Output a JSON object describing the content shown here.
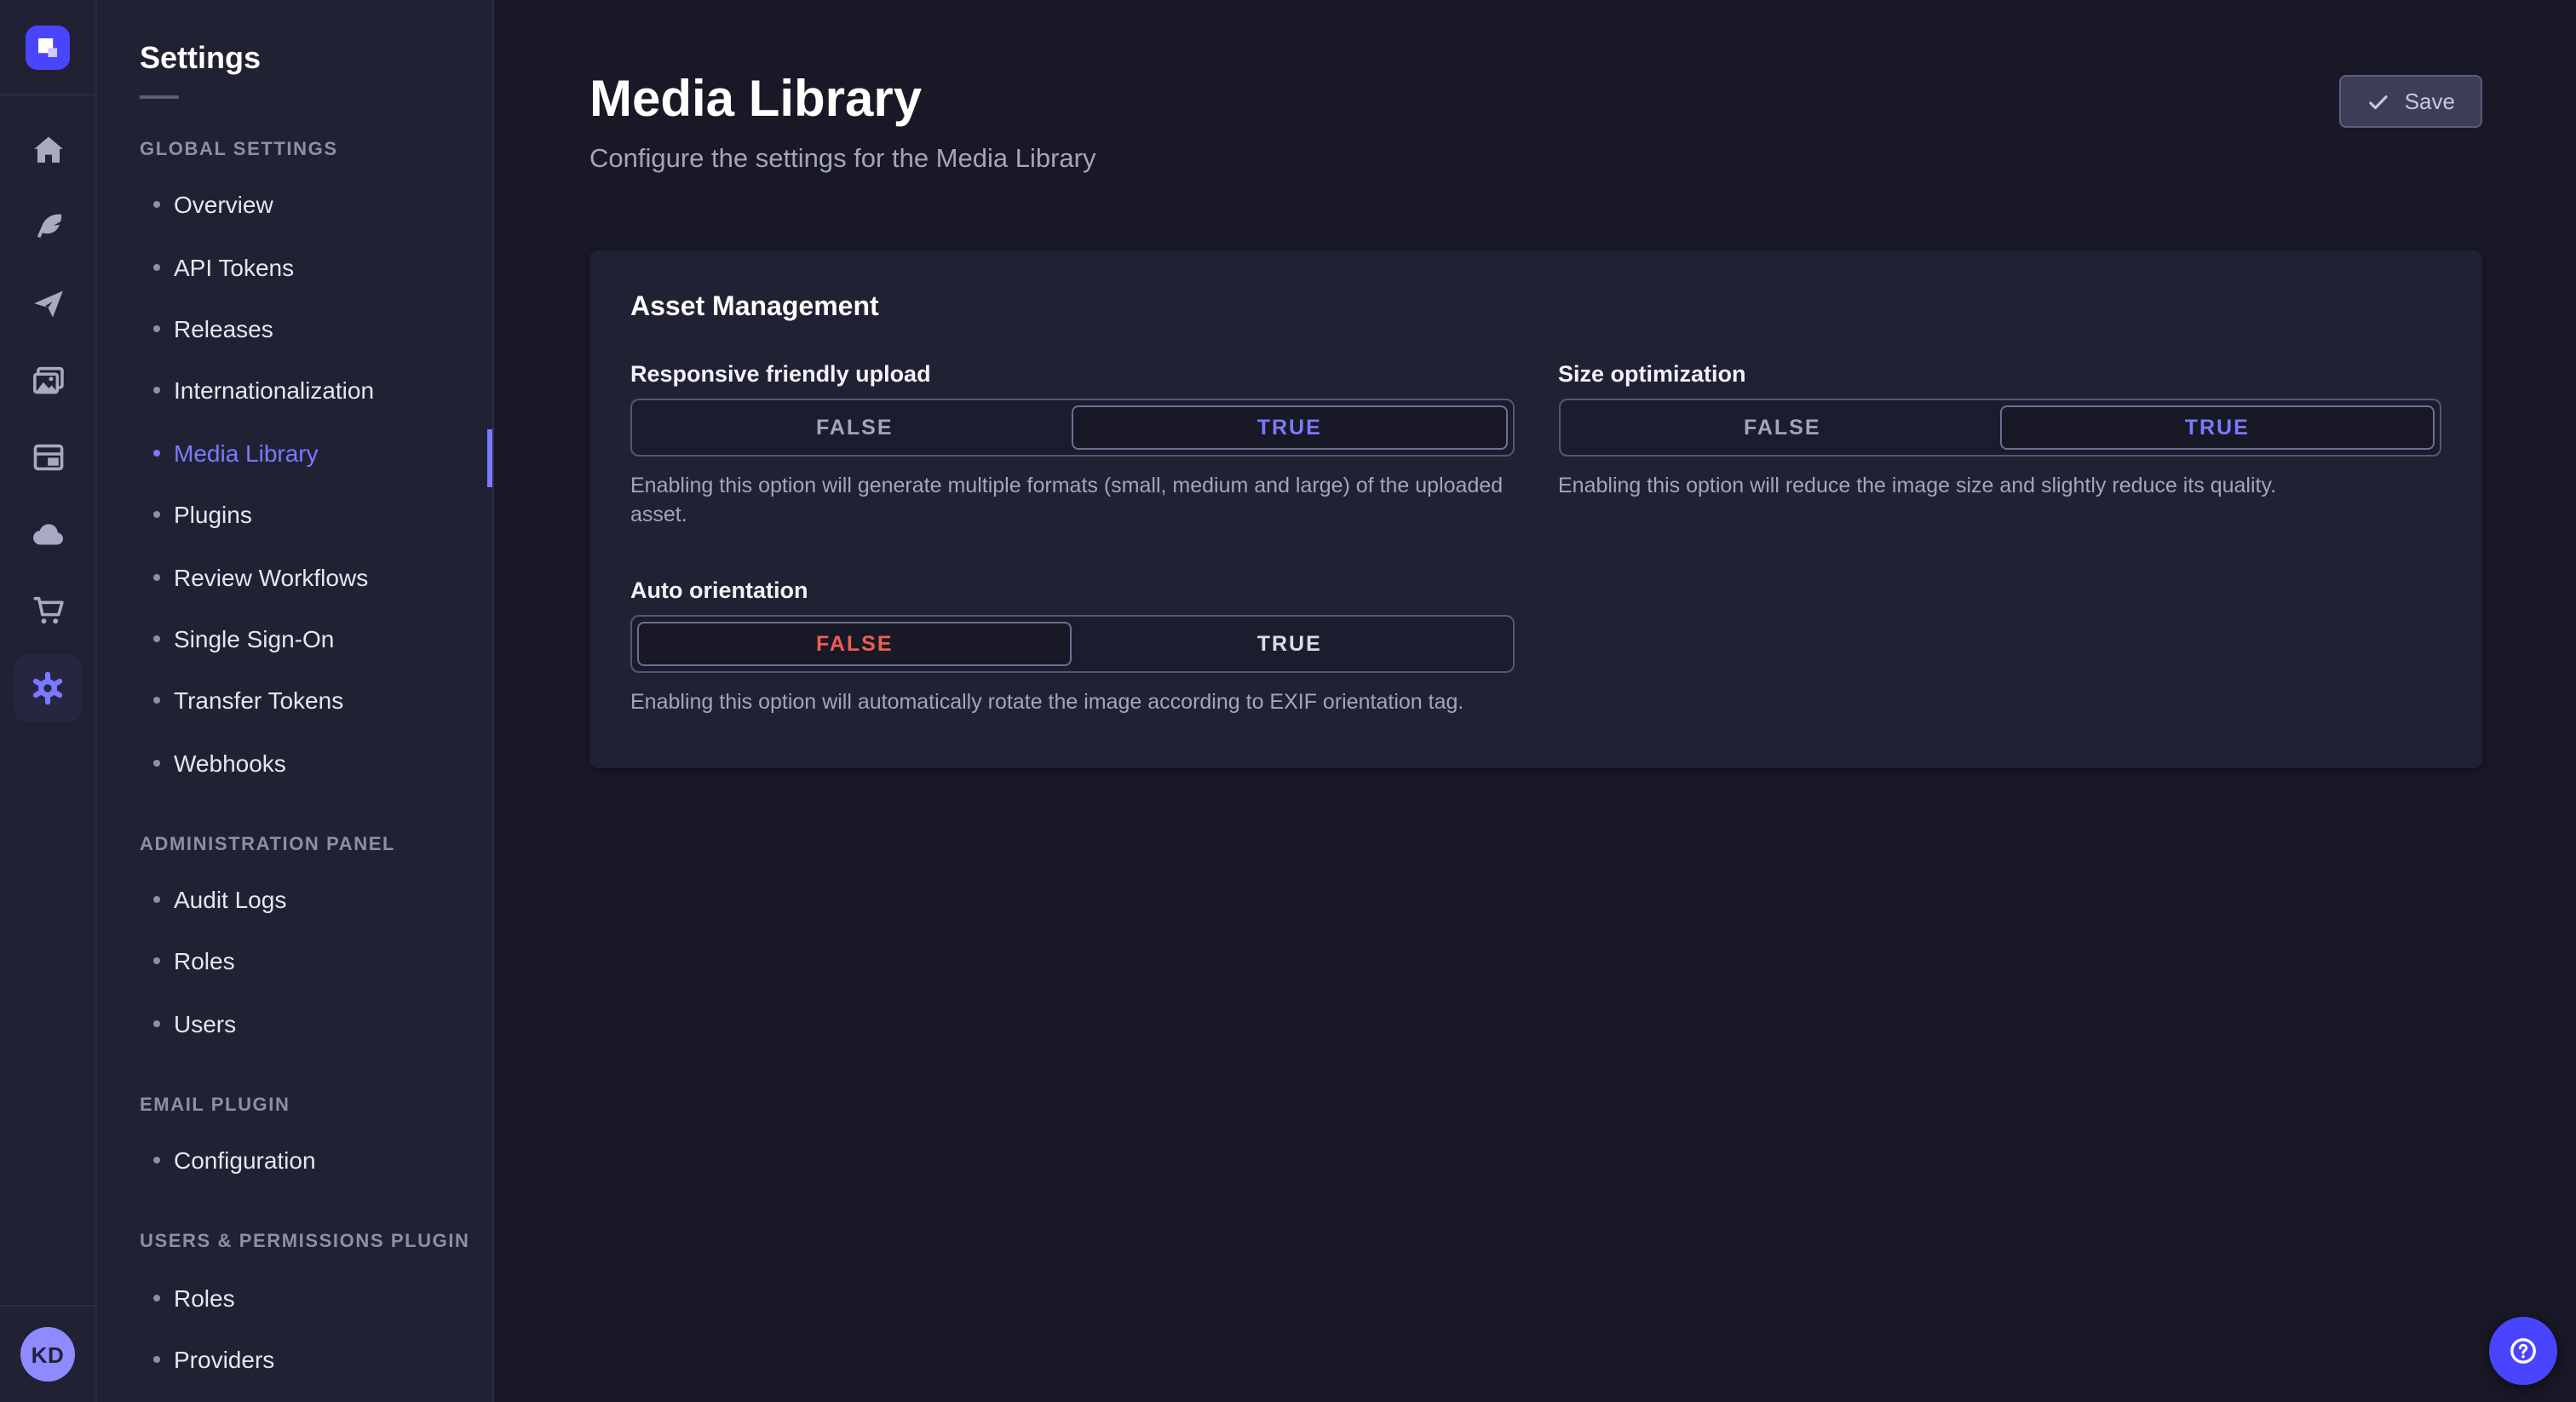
{
  "colors": {
    "background": "#181826",
    "surface": "#212134",
    "accent": "#7b79ff",
    "primary": "#4945ff",
    "danger": "#ee5e52",
    "muted_text": "#a5a5ba"
  },
  "icon_rail": {
    "logo_icon": "strapi-logo",
    "items": [
      "home-icon",
      "feather-icon",
      "paper-plane-icon",
      "pictures-icon",
      "layout-icon",
      "cloud-icon",
      "cart-icon",
      "gear-icon"
    ],
    "active_item": "gear-icon",
    "avatar_initials": "KD"
  },
  "subnav": {
    "title": "Settings",
    "sections": [
      {
        "label": "GLOBAL SETTINGS",
        "items": [
          {
            "label": "Overview"
          },
          {
            "label": "API Tokens"
          },
          {
            "label": "Releases"
          },
          {
            "label": "Internationalization"
          },
          {
            "label": "Media Library",
            "active": true
          },
          {
            "label": "Plugins"
          },
          {
            "label": "Review Workflows"
          },
          {
            "label": "Single Sign-On"
          },
          {
            "label": "Transfer Tokens"
          },
          {
            "label": "Webhooks"
          }
        ]
      },
      {
        "label": "ADMINISTRATION PANEL",
        "items": [
          {
            "label": "Audit Logs"
          },
          {
            "label": "Roles"
          },
          {
            "label": "Users"
          }
        ]
      },
      {
        "label": "EMAIL PLUGIN",
        "items": [
          {
            "label": "Configuration"
          }
        ]
      },
      {
        "label": "USERS & PERMISSIONS PLUGIN",
        "items": [
          {
            "label": "Roles"
          },
          {
            "label": "Providers"
          }
        ]
      }
    ]
  },
  "header": {
    "title": "Media Library",
    "subtitle": "Configure the settings for the Media Library",
    "save_label": "Save"
  },
  "panel": {
    "title": "Asset Management",
    "fields": [
      {
        "label": "Responsive friendly upload",
        "options": [
          "FALSE",
          "TRUE"
        ],
        "value": "TRUE",
        "hint": "Enabling this option will generate multiple formats (small, medium and large) of the uploaded asset."
      },
      {
        "label": "Size optimization",
        "options": [
          "FALSE",
          "TRUE"
        ],
        "value": "TRUE",
        "hint": "Enabling this option will reduce the image size and slightly reduce its quality."
      },
      {
        "label": "Auto orientation",
        "options": [
          "FALSE",
          "TRUE"
        ],
        "value": "FALSE",
        "hint": "Enabling this option will automatically rotate the image according to EXIF orientation tag."
      }
    ]
  },
  "fab": {
    "icon": "question-mark-icon"
  }
}
